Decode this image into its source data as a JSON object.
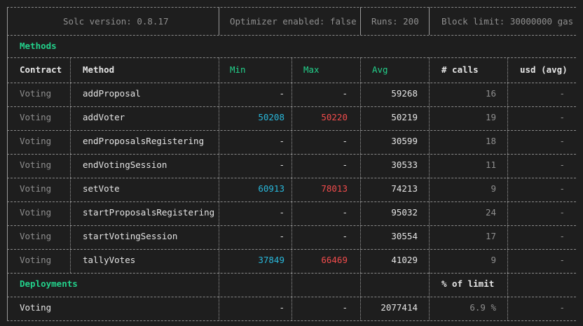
{
  "header": {
    "solc": "Solc version: 0.8.17",
    "optimizer": "Optimizer enabled: false",
    "runs": "Runs: 200",
    "block_limit": "Block limit: 30000000 gas"
  },
  "methods_section": {
    "title": "Methods",
    "columns": {
      "contract": "Contract",
      "method": "Method",
      "min": "Min",
      "max": "Max",
      "avg": "Avg",
      "calls": "# calls",
      "usd": "usd (avg)"
    },
    "rows": [
      {
        "contract": "Voting",
        "method": "addProposal",
        "min": "-",
        "max": "-",
        "avg": "59268",
        "calls": "16",
        "usd": "-"
      },
      {
        "contract": "Voting",
        "method": "addVoter",
        "min": "50208",
        "max": "50220",
        "avg": "50219",
        "calls": "19",
        "usd": "-"
      },
      {
        "contract": "Voting",
        "method": "endProposalsRegistering",
        "min": "-",
        "max": "-",
        "avg": "30599",
        "calls": "18",
        "usd": "-"
      },
      {
        "contract": "Voting",
        "method": "endVotingSession",
        "min": "-",
        "max": "-",
        "avg": "30533",
        "calls": "11",
        "usd": "-"
      },
      {
        "contract": "Voting",
        "method": "setVote",
        "min": "60913",
        "max": "78013",
        "avg": "74213",
        "calls": "9",
        "usd": "-"
      },
      {
        "contract": "Voting",
        "method": "startProposalsRegistering",
        "min": "-",
        "max": "-",
        "avg": "95032",
        "calls": "24",
        "usd": "-"
      },
      {
        "contract": "Voting",
        "method": "startVotingSession",
        "min": "-",
        "max": "-",
        "avg": "30554",
        "calls": "17",
        "usd": "-"
      },
      {
        "contract": "Voting",
        "method": "tallyVotes",
        "min": "37849",
        "max": "66469",
        "avg": "41029",
        "calls": "9",
        "usd": "-"
      }
    ]
  },
  "deployments_section": {
    "title": "Deployments",
    "percent_header": "% of limit",
    "rows": [
      {
        "contract": "Voting",
        "min": "-",
        "max": "-",
        "avg": "2077414",
        "percent": "6.9 %",
        "usd": "-"
      }
    ]
  },
  "colors": {
    "background": "#1e1e1e",
    "section_title": "#23d18b",
    "min_value": "#29b8db",
    "max_value": "#f14c4c"
  }
}
